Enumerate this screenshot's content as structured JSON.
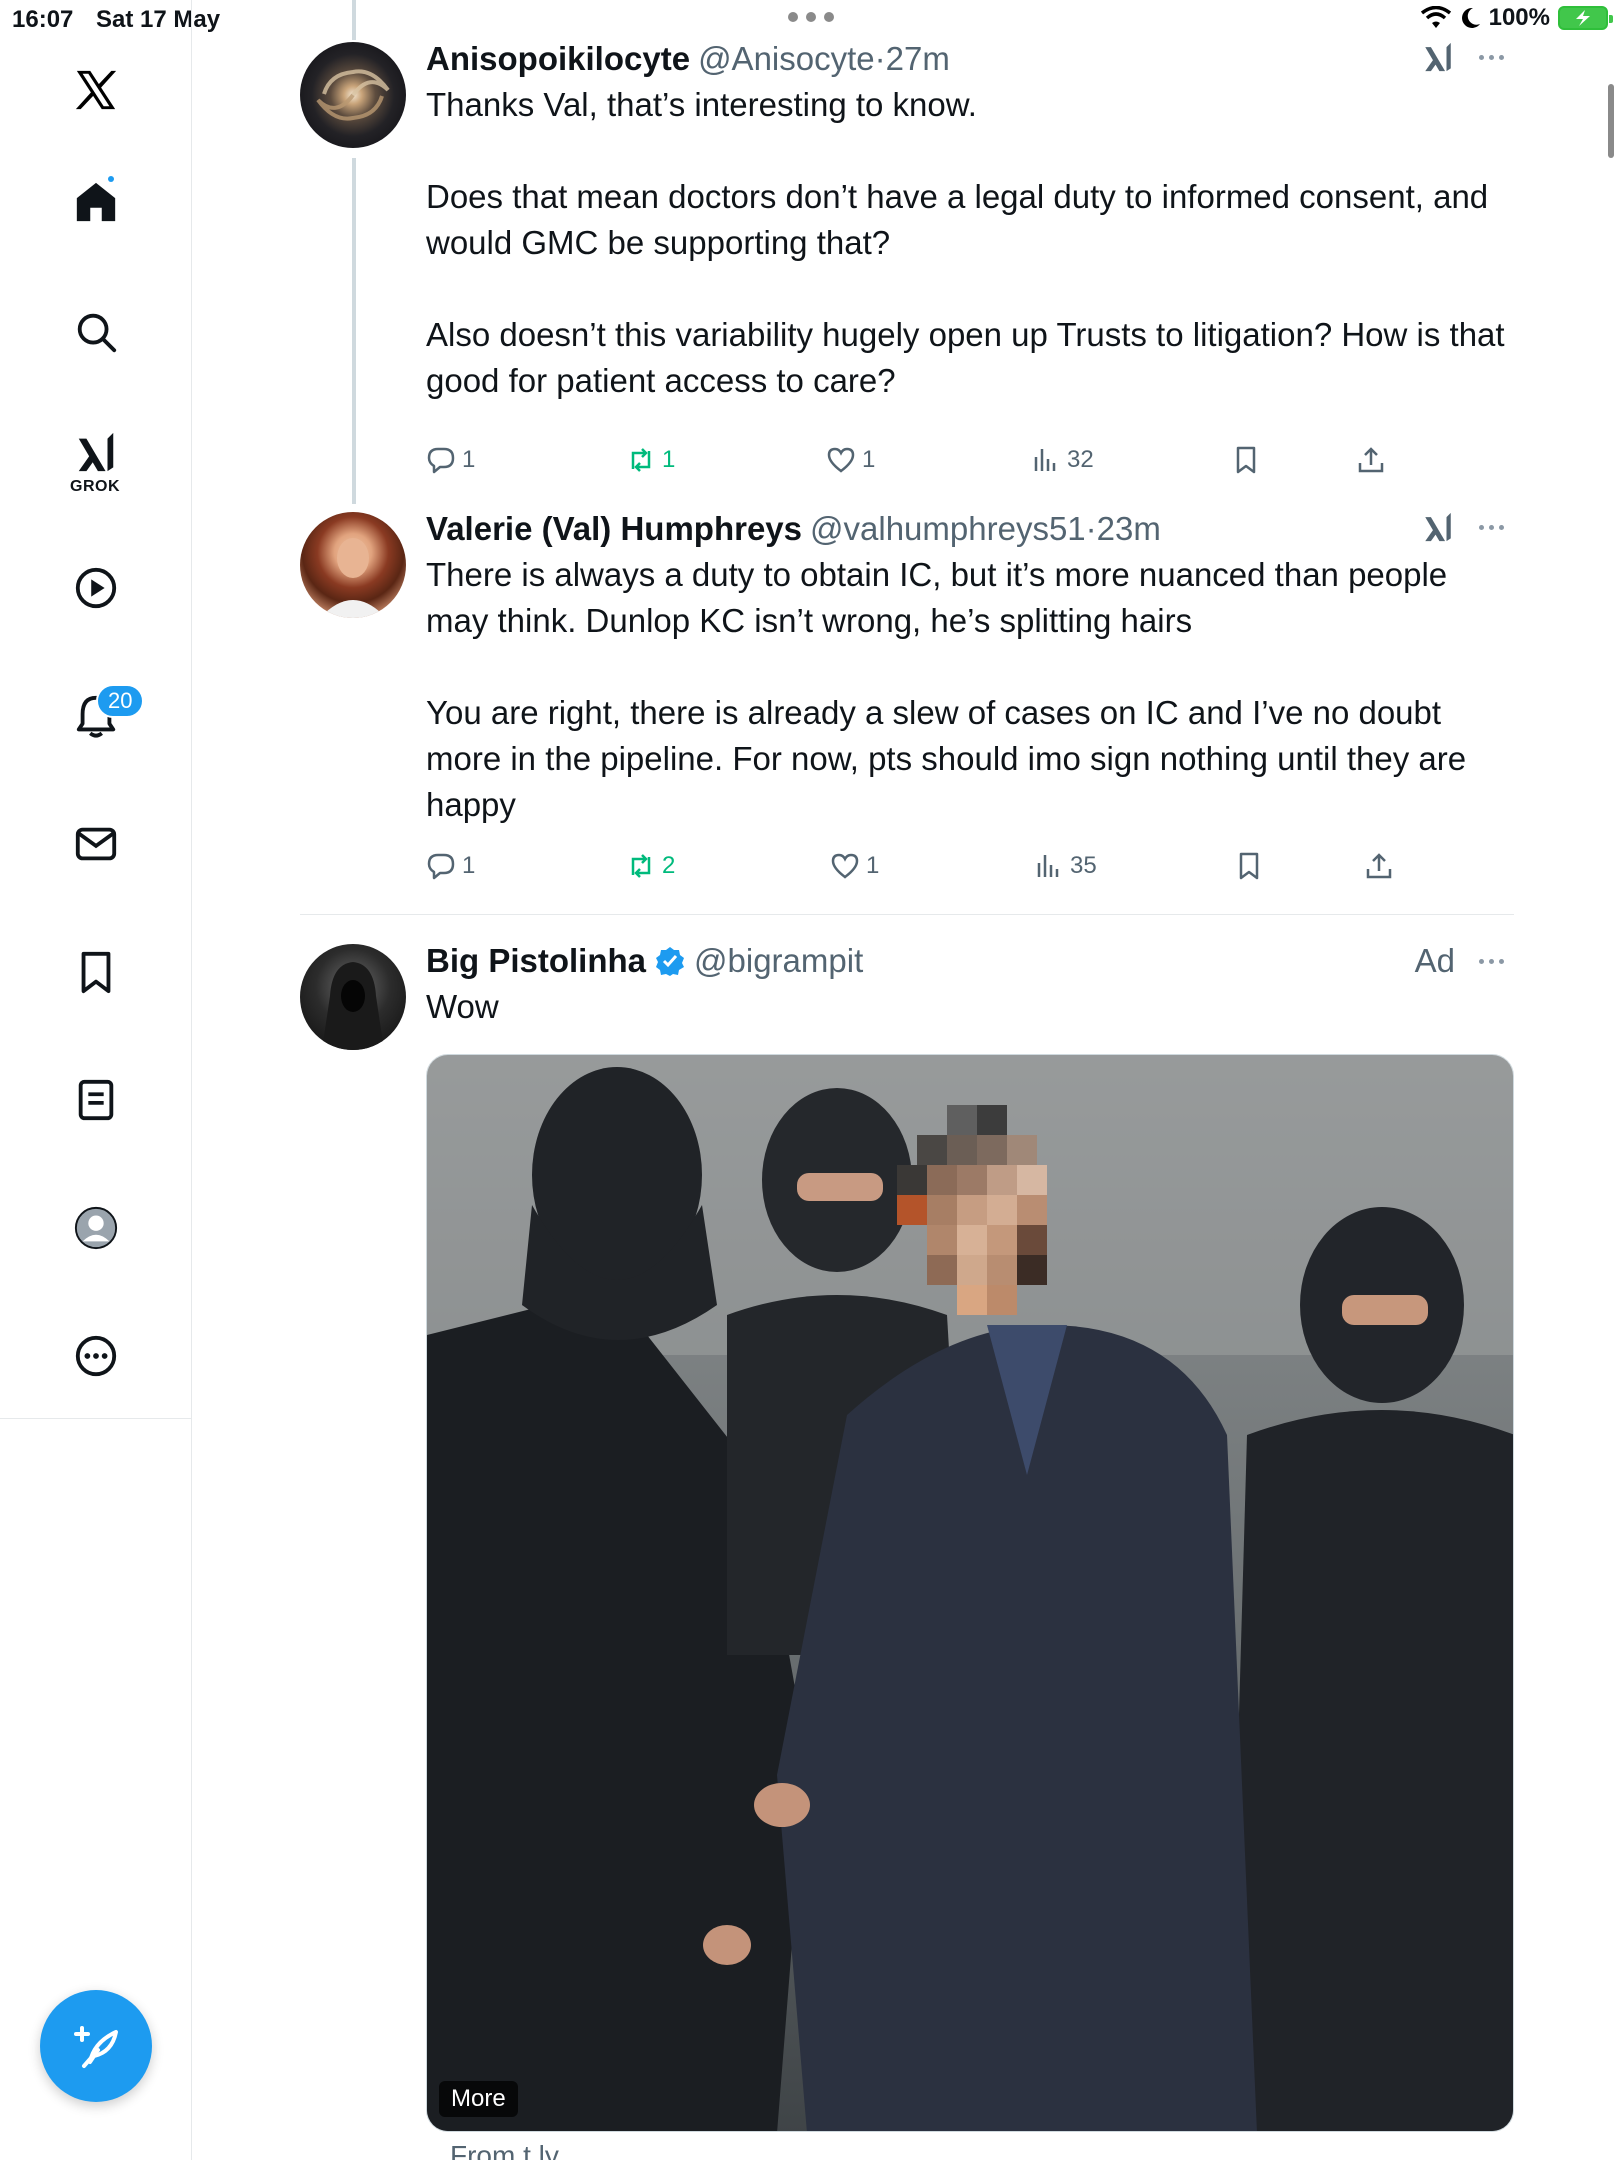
{
  "status_bar": {
    "time": "16:07",
    "date": "Sat 17 May",
    "battery": "100%"
  },
  "sidebar": {
    "grok_label": "GROK",
    "notifications_badge": "20",
    "items": [
      {
        "name": "home"
      },
      {
        "name": "explore"
      },
      {
        "name": "grok"
      },
      {
        "name": "video"
      },
      {
        "name": "notifications"
      },
      {
        "name": "messages"
      },
      {
        "name": "bookmarks"
      },
      {
        "name": "lists"
      },
      {
        "name": "profile"
      },
      {
        "name": "more"
      }
    ]
  },
  "tweets": [
    {
      "name": "Anisopoikilocyte",
      "handle": "@Anisocyte",
      "time": "·27m",
      "text": "Thanks Val, that’s interesting to know.\n\nDoes that mean doctors don’t have a legal duty to informed consent, and would GMC be supporting that?\n\nAlso doesn’t this variability hugely open up Trusts to litigation? How is that good for patient access to care?",
      "replies": "1",
      "retweets": "1",
      "likes": "1",
      "views": "32"
    },
    {
      "name": "Valerie (Val) Humphreys",
      "handle": "@valhumphreys51",
      "time": "·23m",
      "text": "There is always a duty to obtain IC, but it’s more nuanced than people may think. Dunlop KC isn’t wrong, he’s splitting hairs\n\nYou are right, there is already a slew of cases on IC and I’ve no doubt more in the pipeline. For now, pts should imo sign nothing until they are happy",
      "replies": "1",
      "retweets": "2",
      "likes": "1",
      "views": "35"
    },
    {
      "name": "Big Pistolinha",
      "handle": "@bigrampit",
      "ad_label": "Ad",
      "text": "Wow",
      "media_more_label": "More",
      "from_label": "From t.ly"
    }
  ],
  "colors": {
    "accent": "#1d9bf0",
    "retweet": "#00ba7c",
    "muted": "#536471"
  }
}
